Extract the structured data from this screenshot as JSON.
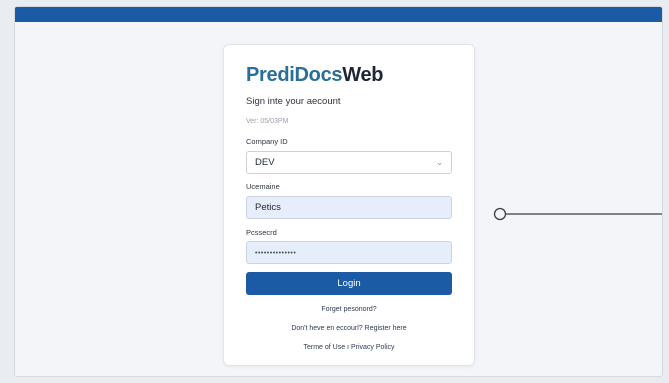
{
  "brand": {
    "part1": "PrediDocs",
    "part2": "Web"
  },
  "subtitle": "Sign inte your aecount",
  "version": "Ver: 05/03PM",
  "company": {
    "label": "Company ID",
    "value": "DEV"
  },
  "username": {
    "label": "Ucemaine",
    "value": "Petics"
  },
  "password": {
    "label": "Pcssecrd",
    "value": "••••••••••••••"
  },
  "login_label": "Login",
  "forgot_label": "Forget pesonord?",
  "register_label": "Don't heve en eccourl? Register here",
  "terms_label": "Terme of Use ı Privacy Policy",
  "colors": {
    "accent": "#1b5aa5",
    "brand": "#2a6f97",
    "field_fill": "#e7eefb"
  },
  "icons": {
    "select": "chevron-down-icon",
    "connector": "circle-connector-icon"
  }
}
